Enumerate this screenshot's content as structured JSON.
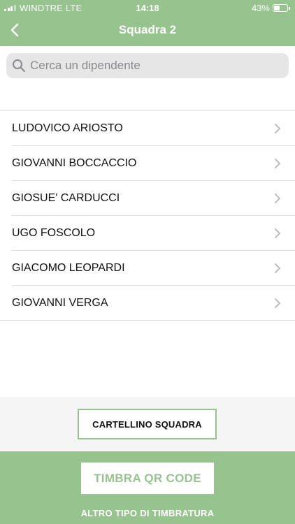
{
  "status_bar": {
    "carrier": "WINDTRE  LTE",
    "time": "14:18",
    "battery": "43%",
    "battery_level": 0.43
  },
  "header": {
    "title": "Squadra 2",
    "back_icon": "chevron-left-icon"
  },
  "search": {
    "placeholder": "Cerca un dipendente",
    "value": "",
    "icon": "search-icon"
  },
  "employees": [
    "LUDOVICO ARIOSTO",
    "GIOVANNI BOCCACCIO",
    "GIOSUE' CARDUCCI",
    "UGO FOSCOLO",
    "GIACOMO LEOPARDI",
    "GIOVANNI VERGA"
  ],
  "actions": {
    "team_card_label": "CARTELLINO SQUADRA",
    "qr_label": "TIMBRA QR CODE",
    "other_label": "ALTRO TIPO DI TIMBRATURA"
  },
  "colors": {
    "accent": "#97c38e",
    "search_bg": "#e6e6e7",
    "divider": "#e0e0e0"
  }
}
